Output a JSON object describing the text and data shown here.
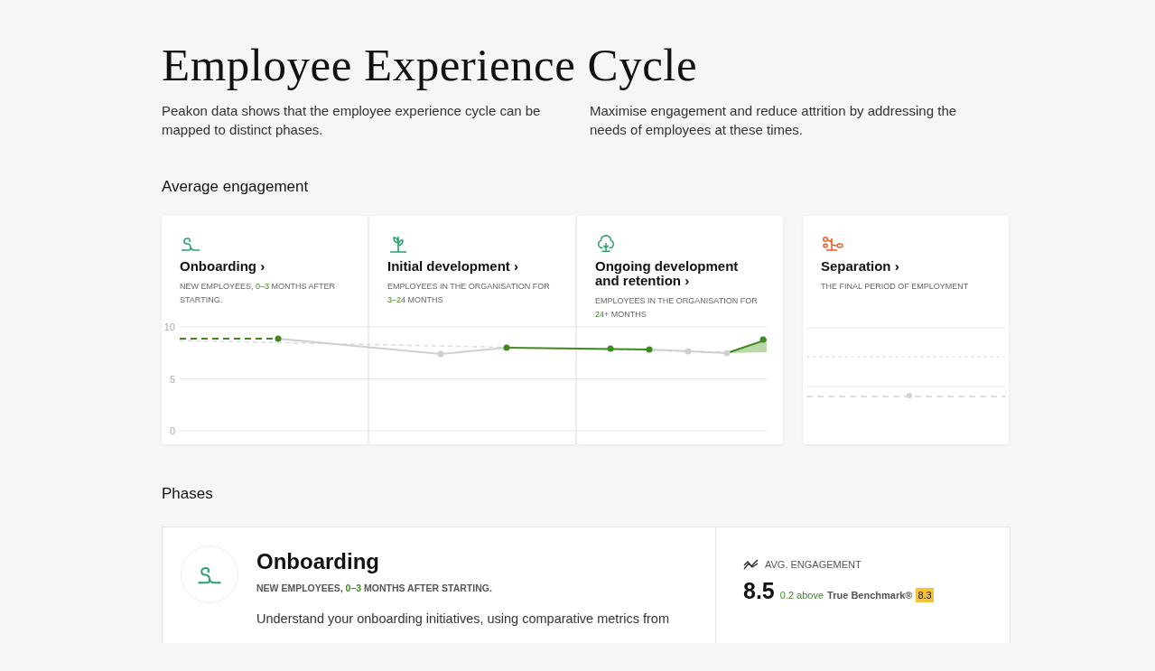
{
  "title": "Employee Experience Cycle",
  "intro": [
    "Peakon data shows that the employee experience cycle can be mapped to distinct phases.",
    "Maximise engagement and reduce attrition by addressing the needs of employees at these times."
  ],
  "engagement_heading": "Average engagement",
  "phase_cards": [
    {
      "kind": "onboarding",
      "title": "Onboarding",
      "arrow": "›",
      "subtitle": [
        {
          "text": "NEW EMPLOYEES, ",
          "highlight": false
        },
        {
          "text": "0–3",
          "highlight": true
        },
        {
          "text": " MONTHS AFTER STARTING.",
          "highlight": false
        }
      ]
    },
    {
      "kind": "initial",
      "title": "Initial development",
      "arrow": "›",
      "subtitle": [
        {
          "text": "EMPLOYEES IN THE ORGANISATION FOR ",
          "highlight": false
        },
        {
          "text": "3–24",
          "highlight": true
        },
        {
          "text": " MONTHS",
          "highlight": false
        }
      ]
    },
    {
      "kind": "ongoing",
      "title": "Ongoing development and retention",
      "arrow": "›",
      "subtitle": [
        {
          "text": "EMPLOYEES IN THE ORGANISATION FOR ",
          "highlight": false
        },
        {
          "text": "24+",
          "highlight": true
        },
        {
          "text": " MONTHS",
          "highlight": false
        }
      ]
    },
    {
      "kind": "separation",
      "title": "Separation",
      "arrow": "›",
      "subtitle": [
        {
          "text": "THE FINAL PERIOD OF EMPLOYMENT",
          "highlight": false
        }
      ]
    }
  ],
  "axis_labels": [
    "10",
    "5",
    "0"
  ],
  "phases_heading": "Phases",
  "phase_detail": {
    "kind": "onboarding",
    "title": "Onboarding",
    "subtitle": [
      {
        "text": "NEW EMPLOYEES, ",
        "highlight": false
      },
      {
        "text": "0–3",
        "highlight": true
      },
      {
        "text": " MONTHS AFTER STARTING.",
        "highlight": false
      }
    ],
    "description": "Understand your onboarding initiatives, using comparative metrics from",
    "metric_label": "AVG. ENGAGEMENT",
    "score": "8.5",
    "difference": "0.2 above",
    "benchmark_label": "True Benchmark®",
    "benchmark_value": "8.3"
  }
}
